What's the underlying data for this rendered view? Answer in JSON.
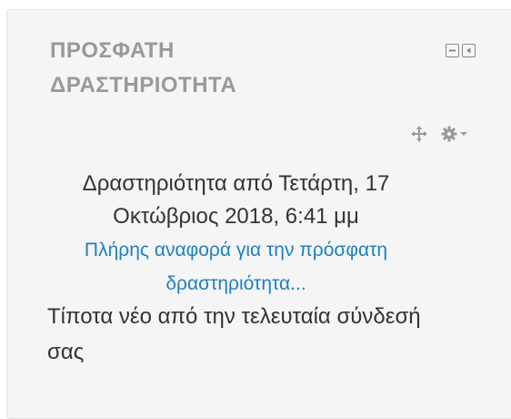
{
  "block": {
    "title_line1": "ΠΡΟΣΦΑΤΗ",
    "title_line2": "ΔΡΑΣΤΗΡΙΟΤΗΤΑ",
    "controls": {
      "hide_icon": "minus-box-icon",
      "dock_icon": "dock-left-icon"
    },
    "actions": {
      "move_icon": "move-icon",
      "settings_icon": "gear-icon",
      "dropdown_icon": "caret-down-icon"
    },
    "activity_since_line1": "Δραστηριότητα από Τετάρτη, 17",
    "activity_since_line2": "Οκτώβριος 2018, 6:41 μμ",
    "full_report_line1": "Πλήρης αναφορά για την πρόσφατη",
    "full_report_line2": "δραστηριότητα...",
    "nothing_new_line1": "Τίποτα νέο από την τελευταία σύνδεσή",
    "nothing_new_line2": "σας"
  },
  "colors": {
    "title": "#999999",
    "text": "#333333",
    "link": "#1f7fc0",
    "background": "#f5f5f5",
    "icon": "#8a8a8a"
  }
}
